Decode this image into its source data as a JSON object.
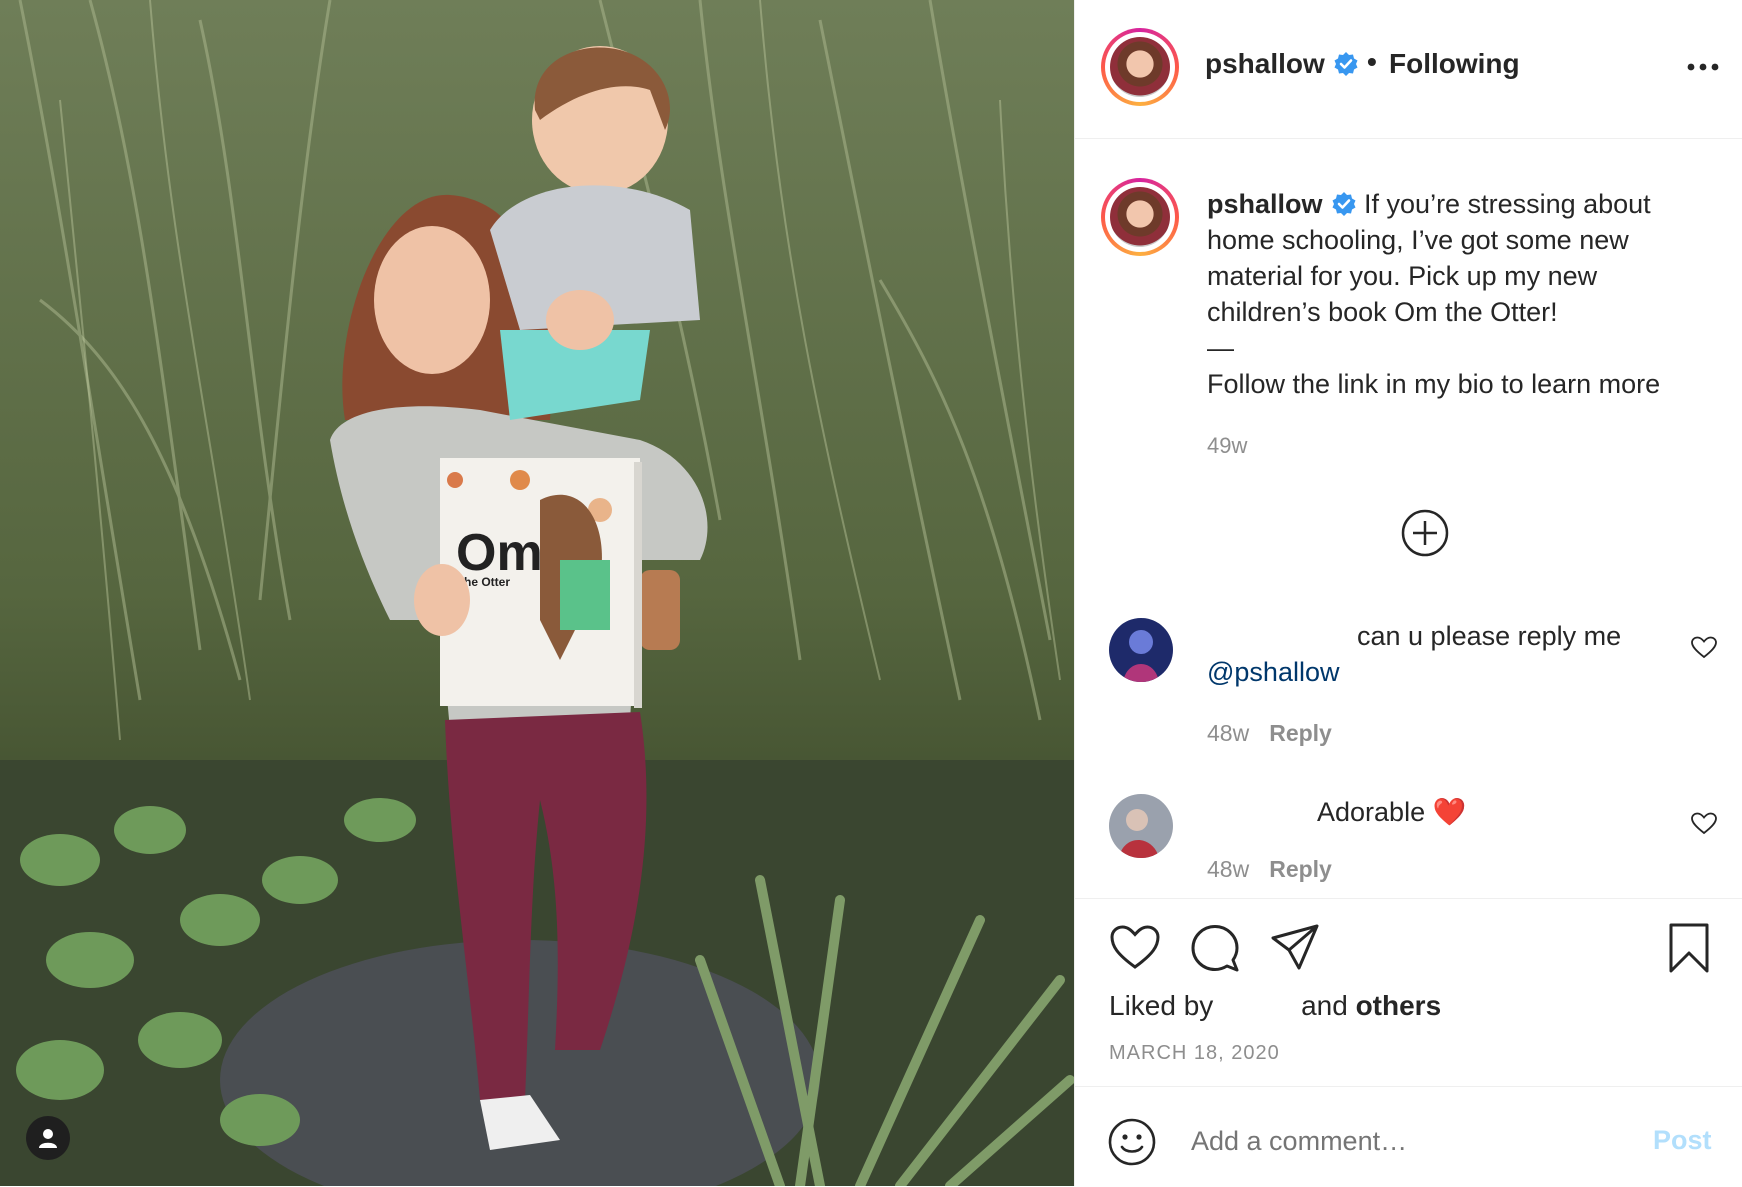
{
  "post": {
    "username": "pshallow",
    "separator": "•",
    "follow_status": "Following",
    "caption_lines": [
      "If you’re stressing about",
      "home schooling, I’ve got some new",
      "material for you. Pick up my new",
      "children’s book Om the Otter!",
      "—",
      "Follow the link in my bio to learn more"
    ],
    "caption_time": "49w",
    "date": "MARCH 18, 2020"
  },
  "book": {
    "title": "Om",
    "subtitle": "the Otter"
  },
  "comments": [
    {
      "text": "can u please reply me",
      "mention": "@pshallow",
      "time": "48w",
      "reply_label": "Reply"
    },
    {
      "text": "Adorable ❤️",
      "time": "48w",
      "reply_label": "Reply"
    }
  ],
  "likes": {
    "prefix": "Liked by",
    "mid": "and",
    "suffix": "others"
  },
  "composer": {
    "placeholder": "Add a comment…",
    "post_label": "Post"
  },
  "icons": [
    "verified-badge-icon",
    "more-options-icon",
    "load-more-icon",
    "heart-icon",
    "comment-icon",
    "share-icon",
    "bookmark-icon",
    "emoji-icon",
    "user-tag-icon"
  ],
  "colors": {
    "verified": "#3897f0",
    "link": "#00376b",
    "post_disabled": "#b2dffc",
    "muted": "#8e8e8e"
  }
}
